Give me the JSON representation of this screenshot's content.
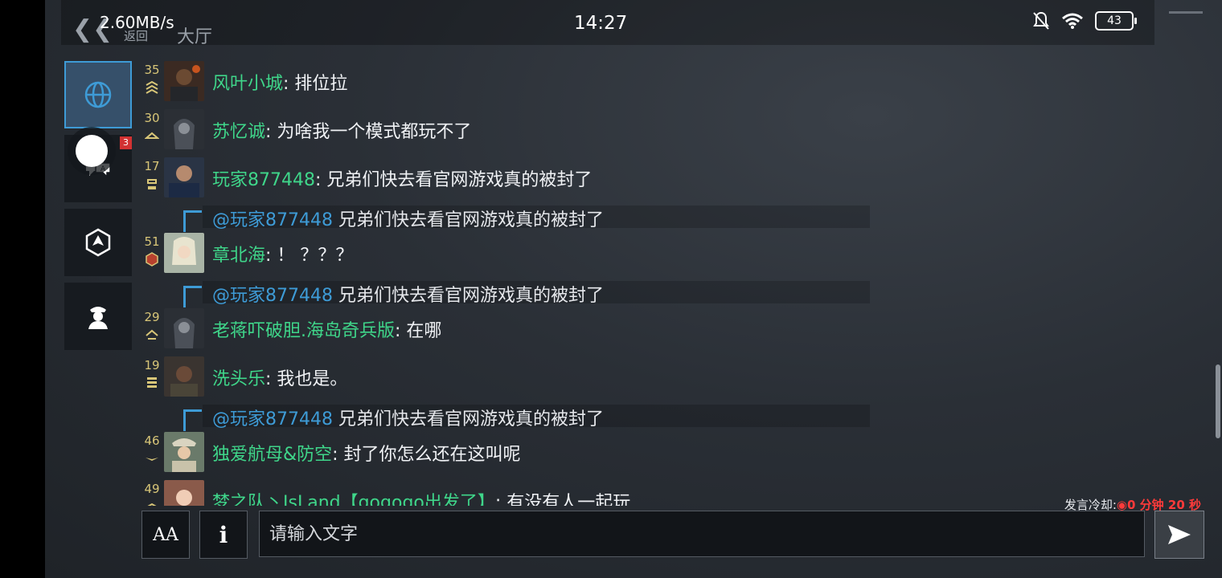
{
  "status_bar": {
    "net_speed": "2.60MB/s",
    "time": "14:27",
    "battery": "43"
  },
  "header": {
    "back_label": "返回",
    "title": "大厅"
  },
  "sidebar": {
    "tabs": [
      {
        "name": "world",
        "icon": "globe-icon",
        "active": true
      },
      {
        "name": "private",
        "icon": "chat-translate-icon",
        "badge": "3"
      },
      {
        "name": "team",
        "icon": "squad-emblem-icon"
      },
      {
        "name": "guild",
        "icon": "soldier-icon"
      }
    ]
  },
  "messages": [
    {
      "level": "35",
      "name": "风叶小城",
      "text": ": 排位拉"
    },
    {
      "level": "30",
      "name": "苏忆诚",
      "text": ": 为啥我一个模式都玩不了"
    },
    {
      "level": "17",
      "name": "玩家877448",
      "text": ": 兄弟们快去看官网游戏真的被封了"
    },
    {
      "reply_to": "@玩家877448",
      "quote": " 兄弟们快去看官网游戏真的被封了"
    },
    {
      "level": "51",
      "name": "章北海",
      "text": ": ！ ？？？"
    },
    {
      "reply_to": "@玩家877448",
      "quote": " 兄弟们快去看官网游戏真的被封了"
    },
    {
      "level": "29",
      "name": "老蒋吓破胆.海岛奇兵版",
      "text": ": 在哪"
    },
    {
      "level": "19",
      "name": "洗头乐",
      "text": ": 我也是。"
    },
    {
      "reply_to": "@玩家877448",
      "quote": " 兄弟们快去看官网游戏真的被封了"
    },
    {
      "level": "46",
      "name": "独爱航母&防空",
      "text": ": 封了你怎么还在这叫呢"
    },
    {
      "level": "49",
      "name": "梦之队丶IsLand【gogogo出发了】",
      "text": ": 有没有人一起玩"
    }
  ],
  "cooldown": {
    "label": "发言冷却:",
    "value": "0 分钟 20 秒"
  },
  "input": {
    "font_button": "AA",
    "info_button": "i",
    "placeholder": "请输入文字"
  },
  "colors": {
    "name": "#3fd68a",
    "mention": "#3e9bd6",
    "level": "#d8c678",
    "cooldown": "#ff3a3a"
  }
}
